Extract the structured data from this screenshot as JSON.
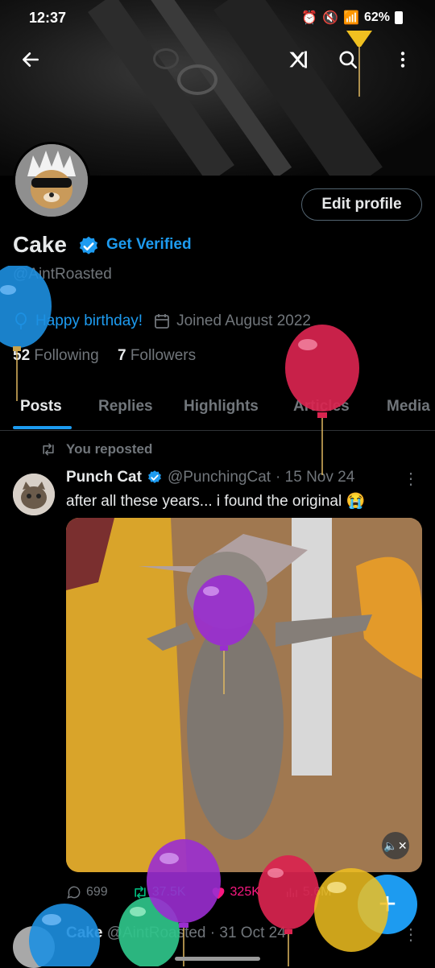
{
  "status_bar": {
    "time": "12:37",
    "battery": "62%"
  },
  "profile": {
    "name": "Cake",
    "get_verified": "Get Verified",
    "handle": "@AintRoasted",
    "birthday": "Happy birthday!",
    "joined": "Joined August 2022",
    "following_count": "52",
    "following_label": "Following",
    "followers_count": "7",
    "followers_label": "Followers",
    "edit_button": "Edit profile"
  },
  "tabs": [
    "Posts",
    "Replies",
    "Highlights",
    "Articles",
    "Media"
  ],
  "feed": {
    "repost_label": "You reposted",
    "post1": {
      "author": "Punch Cat",
      "handle": "@PunchingCat",
      "date": "· 15 Nov 24",
      "text": "after all these years... i found the original 😭",
      "replies": "699",
      "reposts": "37.5K",
      "likes": "325K",
      "views": "5.6M"
    },
    "post2": {
      "author": "Cake",
      "handle": "@AintRoasted",
      "date": "· 31 Oct 24"
    }
  },
  "fab_label": "+",
  "colors": {
    "accent": "#1d9bf0",
    "like": "#f91880",
    "muted": "#71767b"
  }
}
